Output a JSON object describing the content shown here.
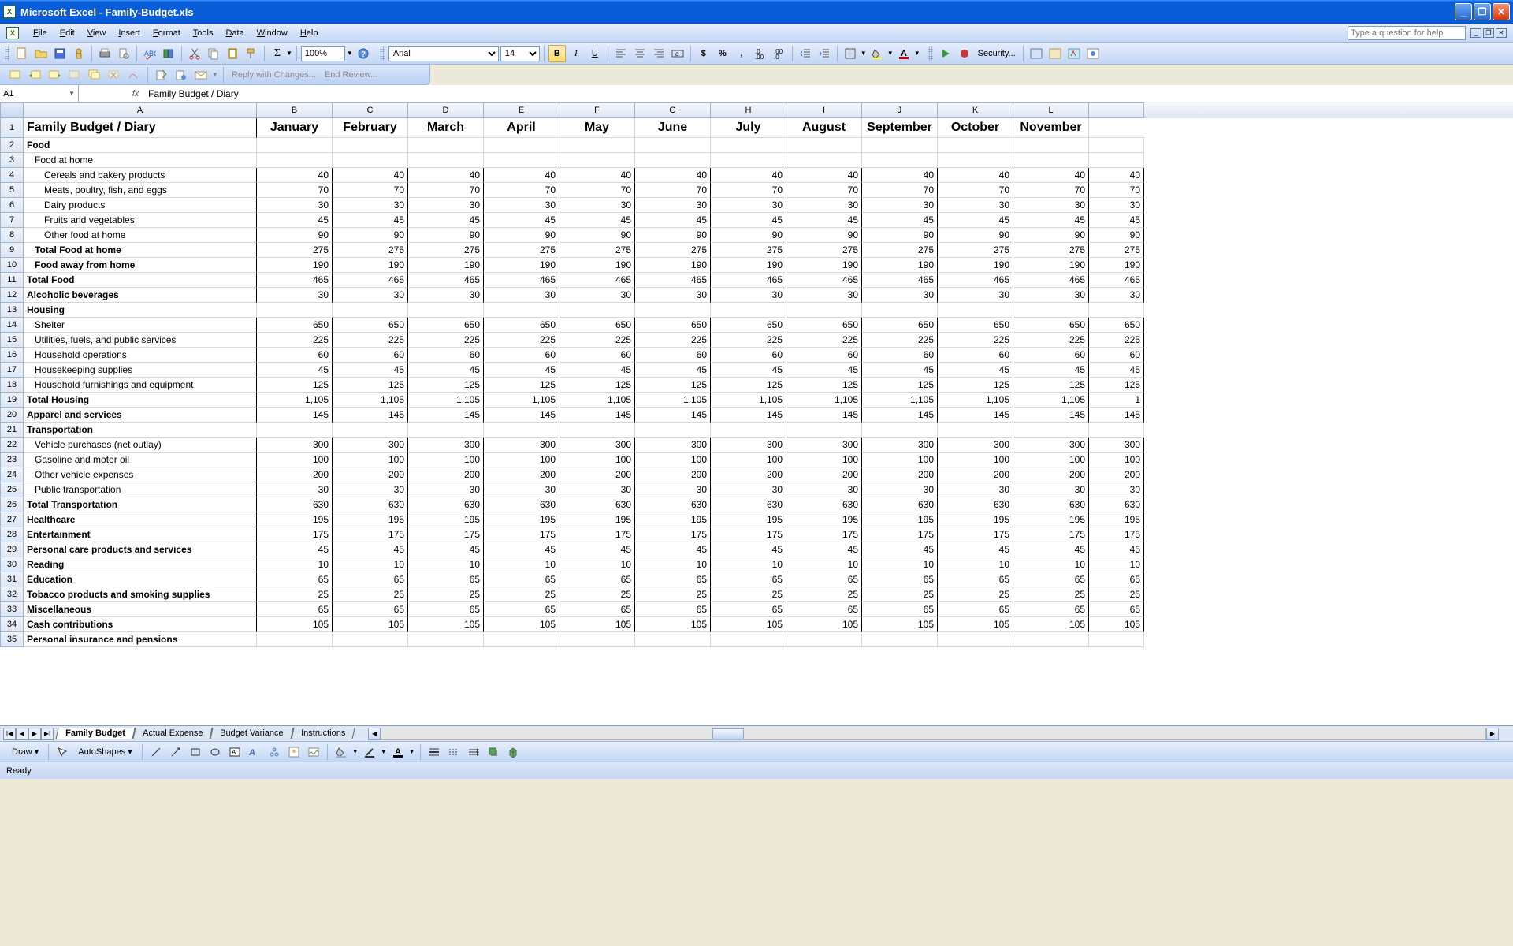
{
  "app": {
    "title": "Microsoft Excel - Family-Budget.xls"
  },
  "menu": {
    "items": [
      "File",
      "Edit",
      "View",
      "Insert",
      "Format",
      "Tools",
      "Data",
      "Window",
      "Help"
    ],
    "help_placeholder": "Type a question for help"
  },
  "toolbar": {
    "zoom": "100%",
    "font": "Arial",
    "size": "14",
    "security": "Security...",
    "reply": "Reply with Changes...",
    "end": "End Review..."
  },
  "namebox": {
    "ref": "A1"
  },
  "formula": {
    "value": "Family Budget / Diary"
  },
  "columns": [
    "A",
    "B",
    "C",
    "D",
    "E",
    "F",
    "G",
    "H",
    "I",
    "J",
    "K",
    "L"
  ],
  "months": [
    "January",
    "February",
    "March",
    "April",
    "May",
    "June",
    "July",
    "August",
    "September",
    "October",
    "November"
  ],
  "rows": [
    {
      "n": 1,
      "label": "Family Budget / Diary",
      "cls": "title",
      "vals": "months_header"
    },
    {
      "n": 2,
      "label": "Food",
      "cls": "bold",
      "vals": null
    },
    {
      "n": 3,
      "label": "Food at home",
      "cls": "indent1",
      "vals": null
    },
    {
      "n": 4,
      "label": "Cereals and bakery products",
      "cls": "indent2",
      "vals": 40
    },
    {
      "n": 5,
      "label": "Meats, poultry, fish, and eggs",
      "cls": "indent2",
      "vals": 70
    },
    {
      "n": 6,
      "label": "Dairy products",
      "cls": "indent2",
      "vals": 30
    },
    {
      "n": 7,
      "label": "Fruits and vegetables",
      "cls": "indent2",
      "vals": 45
    },
    {
      "n": 8,
      "label": "Other food at home",
      "cls": "indent2",
      "vals": 90
    },
    {
      "n": 9,
      "label": "Total Food at home",
      "cls": "bold indent1",
      "vals": 275
    },
    {
      "n": 10,
      "label": "Food away from home",
      "cls": "bold indent1",
      "vals": 190
    },
    {
      "n": 11,
      "label": "Total Food",
      "cls": "bold",
      "vals": 465
    },
    {
      "n": 12,
      "label": "Alcoholic beverages",
      "cls": "bold",
      "vals": 30
    },
    {
      "n": 13,
      "label": "Housing",
      "cls": "bold",
      "vals": null
    },
    {
      "n": 14,
      "label": "Shelter",
      "cls": "indent1",
      "vals": 650
    },
    {
      "n": 15,
      "label": "Utilities, fuels, and public services",
      "cls": "indent1",
      "vals": 225
    },
    {
      "n": 16,
      "label": "Household operations",
      "cls": "indent1",
      "vals": 60
    },
    {
      "n": 17,
      "label": "Housekeeping supplies",
      "cls": "indent1",
      "vals": 45
    },
    {
      "n": 18,
      "label": "Household furnishings and equipment",
      "cls": "indent1",
      "vals": 125
    },
    {
      "n": 19,
      "label": "Total Housing",
      "cls": "bold",
      "vals": "1,105"
    },
    {
      "n": 20,
      "label": "Apparel and services",
      "cls": "bold",
      "vals": 145
    },
    {
      "n": 21,
      "label": "Transportation",
      "cls": "bold",
      "vals": null
    },
    {
      "n": 22,
      "label": "Vehicle purchases (net outlay)",
      "cls": "indent1",
      "vals": 300
    },
    {
      "n": 23,
      "label": "Gasoline and motor oil",
      "cls": "indent1",
      "vals": 100
    },
    {
      "n": 24,
      "label": "Other vehicle expenses",
      "cls": "indent1",
      "vals": 200
    },
    {
      "n": 25,
      "label": "Public transportation",
      "cls": "indent1",
      "vals": 30
    },
    {
      "n": 26,
      "label": "Total Transportation",
      "cls": "bold",
      "vals": 630
    },
    {
      "n": 27,
      "label": "Healthcare",
      "cls": "bold",
      "vals": 195
    },
    {
      "n": 28,
      "label": "Entertainment",
      "cls": "bold",
      "vals": 175
    },
    {
      "n": 29,
      "label": "Personal care products and services",
      "cls": "bold",
      "vals": 45
    },
    {
      "n": 30,
      "label": "Reading",
      "cls": "bold",
      "vals": 10
    },
    {
      "n": 31,
      "label": "Education",
      "cls": "bold",
      "vals": 65
    },
    {
      "n": 32,
      "label": "Tobacco products and smoking supplies",
      "cls": "bold",
      "vals": 25
    },
    {
      "n": 33,
      "label": "Miscellaneous",
      "cls": "bold",
      "vals": 65
    },
    {
      "n": 34,
      "label": "Cash contributions",
      "cls": "bold",
      "vals": 105
    },
    {
      "n": 35,
      "label": "Personal insurance and pensions",
      "cls": "bold",
      "vals": null
    }
  ],
  "tabs": {
    "items": [
      "Family Budget",
      "Actual Expense",
      "Budget Variance",
      "Instructions"
    ],
    "active": 0
  },
  "draw": {
    "label": "Draw",
    "autoshapes": "AutoShapes"
  },
  "status": {
    "text": "Ready"
  }
}
